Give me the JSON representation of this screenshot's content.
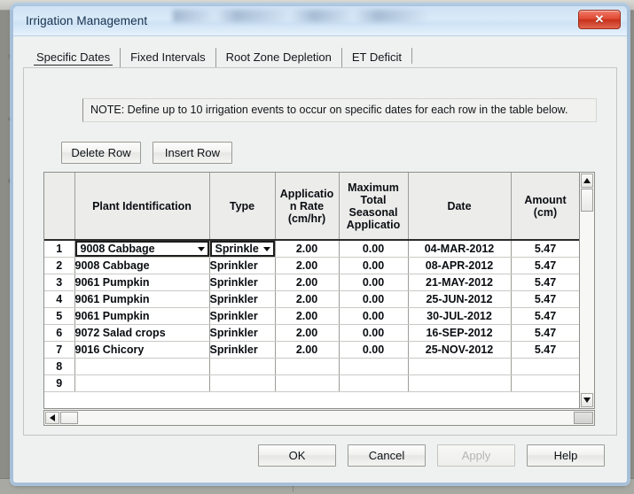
{
  "window": {
    "title": "Irrigation Management",
    "close_label": "✕",
    "close_icon": "close-icon"
  },
  "tabs": [
    {
      "label": "Specific Dates",
      "active": true
    },
    {
      "label": "Fixed Intervals",
      "active": false
    },
    {
      "label": "Root Zone Depletion",
      "active": false
    },
    {
      "label": "ET Deficit",
      "active": false
    }
  ],
  "note": {
    "text": "NOTE:  Define up to 10 irrigation events to occur on specific dates for each row in the table below."
  },
  "row_buttons": {
    "delete_row": "Delete Row",
    "insert_row": "Insert Row"
  },
  "grid": {
    "columns": [
      {
        "key": "rownum",
        "label": ""
      },
      {
        "key": "plant",
        "label": "Plant Identification"
      },
      {
        "key": "type",
        "label": "Type"
      },
      {
        "key": "rate",
        "label_lines": [
          "Applicatio",
          "n Rate",
          "(cm/hr)"
        ]
      },
      {
        "key": "max",
        "label_lines": [
          "Maximum",
          "Total",
          "Seasonal",
          "Applicatio"
        ]
      },
      {
        "key": "date",
        "label": "Date"
      },
      {
        "key": "amount",
        "label_lines": [
          "Amount",
          "(cm)"
        ]
      }
    ],
    "header": {
      "plant": "Plant Identification",
      "type": "Type",
      "rate_l1": "Applicatio",
      "rate_l2": "n Rate",
      "rate_l3": "(cm/hr)",
      "max_l1": "Maximum",
      "max_l2": "Total",
      "max_l3": "Seasonal",
      "max_l4": "Applicatio",
      "date": "Date",
      "amount_l1": "Amount",
      "amount_l2": "(cm)"
    },
    "rows": [
      {
        "num": "1",
        "plant": "9008  Cabbage",
        "type": "Sprinkle",
        "rate": "2.00",
        "max": "0.00",
        "date": "04-MAR-2012",
        "amount": "5.47",
        "active": true
      },
      {
        "num": "2",
        "plant": "9008  Cabbage",
        "type": "Sprinkler",
        "rate": "2.00",
        "max": "0.00",
        "date": "08-APR-2012",
        "amount": "5.47",
        "active": false
      },
      {
        "num": "3",
        "plant": "9061  Pumpkin",
        "type": "Sprinkler",
        "rate": "2.00",
        "max": "0.00",
        "date": "21-MAY-2012",
        "amount": "5.47",
        "active": false
      },
      {
        "num": "4",
        "plant": "9061  Pumpkin",
        "type": "Sprinkler",
        "rate": "2.00",
        "max": "0.00",
        "date": "25-JUN-2012",
        "amount": "5.47",
        "active": false
      },
      {
        "num": "5",
        "plant": "9061  Pumpkin",
        "type": "Sprinkler",
        "rate": "2.00",
        "max": "0.00",
        "date": "30-JUL-2012",
        "amount": "5.47",
        "active": false
      },
      {
        "num": "6",
        "plant": "9072  Salad crops",
        "type": "Sprinkler",
        "rate": "2.00",
        "max": "0.00",
        "date": "16-SEP-2012",
        "amount": "5.47",
        "active": false
      },
      {
        "num": "7",
        "plant": "9016  Chicory",
        "type": "Sprinkler",
        "rate": "2.00",
        "max": "0.00",
        "date": "25-NOV-2012",
        "amount": "5.47",
        "active": false
      },
      {
        "num": "8",
        "plant": "",
        "type": "",
        "rate": "",
        "max": "",
        "date": "",
        "amount": "",
        "active": false
      },
      {
        "num": "9",
        "plant": "",
        "type": "",
        "rate": "",
        "max": "",
        "date": "",
        "amount": "",
        "active": false
      }
    ]
  },
  "scrollbars": {
    "v_up_icon": "scroll-up-icon",
    "v_down_icon": "scroll-down-icon",
    "h_left_icon": "scroll-left-icon",
    "h_right_icon": "scroll-right-icon"
  },
  "dialog_buttons": {
    "ok": "OK",
    "cancel": "Cancel",
    "apply": "Apply",
    "help": "Help"
  }
}
